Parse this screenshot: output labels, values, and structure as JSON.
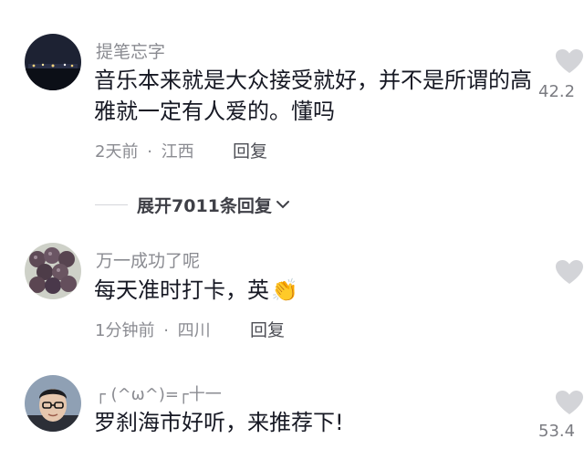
{
  "colors": {
    "text": "#161823",
    "meta": "#8a8b91",
    "heart": "#d3d4d8"
  },
  "comments": [
    {
      "username": "提笔忘字",
      "text": "音乐本来就是大众接受就好，并不是所谓的高雅就一定有人爱的。懂吗",
      "time": "2天前",
      "sep": "·",
      "location": "江西",
      "reply": "回复",
      "likes": "42.2",
      "avatar": "night-city-avatar"
    },
    {
      "username": "万一成功了呢",
      "text": "每天准时打卡，英",
      "emoji": "👏",
      "time": "1分钟前",
      "sep": "·",
      "location": "四川",
      "reply": "回复",
      "likes": "",
      "avatar": "grapes-avatar"
    },
    {
      "username": "┌ (^ω^)=┌十一",
      "text": "罗刹海市好听，来推荐下!",
      "likes": "53.4",
      "avatar": "man-glasses-avatar"
    }
  ],
  "expand": {
    "label": "展开7011条回复"
  }
}
